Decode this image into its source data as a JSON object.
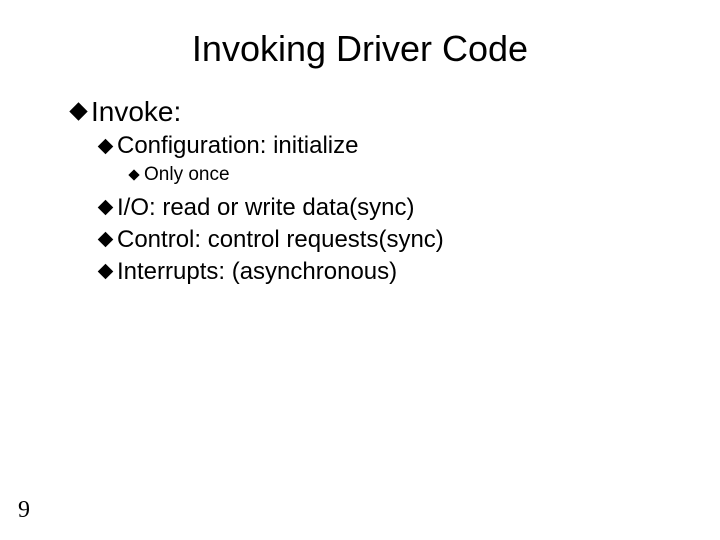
{
  "title": "Invoking Driver Code",
  "items": {
    "l1_0": "Invoke:",
    "l2_0": "Configuration: initialize",
    "l3_0": "Only once",
    "l2_1": "I/O: read or write data(sync)",
    "l2_2": "Control: control requests(sync)",
    "l2_3": "Interrupts: (asynchronous)"
  },
  "page_number": "9"
}
